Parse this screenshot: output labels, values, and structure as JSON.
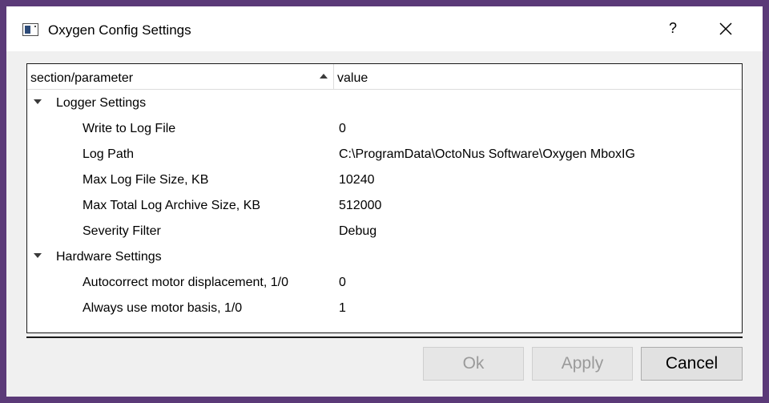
{
  "window": {
    "title": "Oxygen Config Settings",
    "help_label": "?",
    "close_icon": "close-icon",
    "app_icon": "window-app-icon"
  },
  "tree": {
    "headers": {
      "col1": "section/parameter",
      "col2": "value",
      "sort": "ascending"
    },
    "rows": [
      {
        "type": "section",
        "label": "Logger Settings",
        "value": "",
        "expanded": true
      },
      {
        "type": "param",
        "label": "Write to Log File",
        "value": "0"
      },
      {
        "type": "param",
        "label": "Log Path",
        "value": "C:\\ProgramData\\OctoNus Software\\Oxygen MboxIG"
      },
      {
        "type": "param",
        "label": "Max Log File Size, KB",
        "value": "10240"
      },
      {
        "type": "param",
        "label": "Max Total Log Archive Size, KB",
        "value": "512000"
      },
      {
        "type": "param",
        "label": "Severity Filter",
        "value": "Debug"
      },
      {
        "type": "section",
        "label": "Hardware Settings",
        "value": "",
        "expanded": true
      },
      {
        "type": "param",
        "label": "Autocorrect motor displacement, 1/0",
        "value": "0"
      },
      {
        "type": "param",
        "label": "Always use motor basis, 1/0",
        "value": "1"
      }
    ]
  },
  "buttons": {
    "ok": {
      "label": "Ok",
      "enabled": false
    },
    "apply": {
      "label": "Apply",
      "enabled": false
    },
    "cancel": {
      "label": "Cancel",
      "enabled": true
    }
  },
  "colors": {
    "frame": "#5b3a78",
    "dialog_bg": "#f0f0f0",
    "disabled_text": "#9a9a9a"
  }
}
